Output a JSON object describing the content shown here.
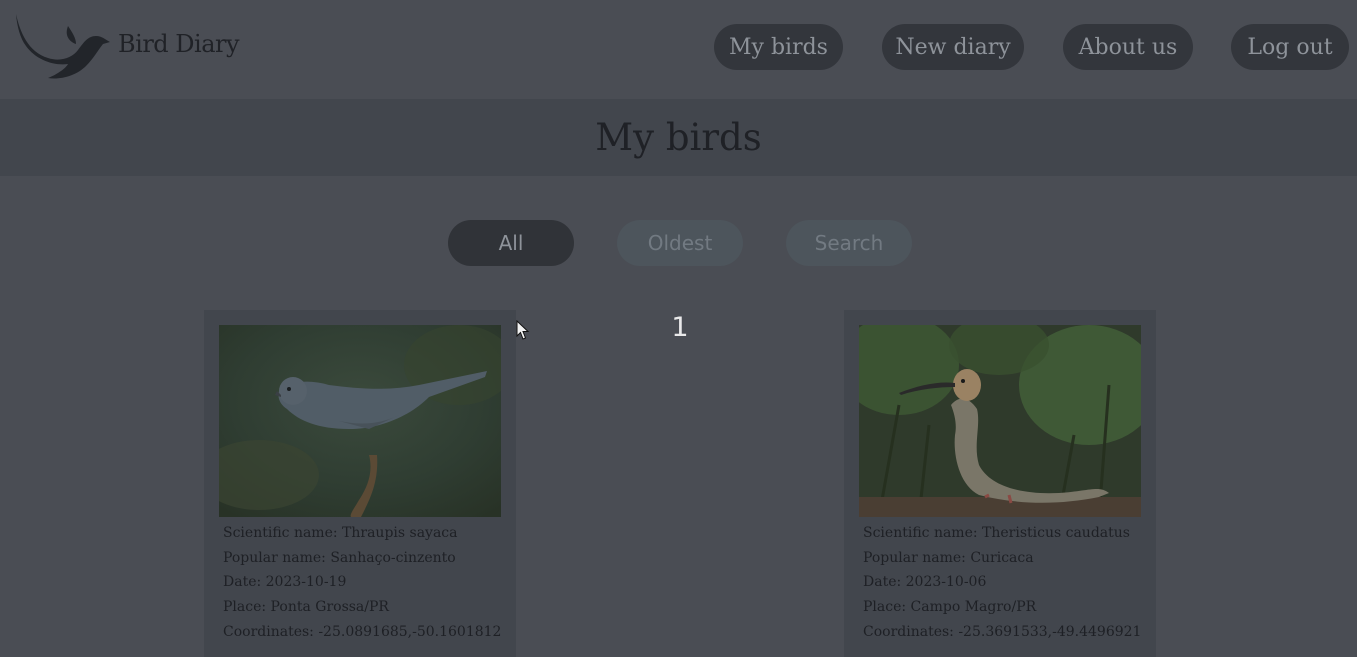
{
  "header": {
    "brand": "Bird Diary"
  },
  "nav": {
    "my_birds": "My birds",
    "new_diary": "New diary",
    "about_us": "About us",
    "log_out": "Log out"
  },
  "page": {
    "title": "My birds",
    "page_number": "1"
  },
  "filters": {
    "all": "All",
    "oldest": "Oldest",
    "search": "Search"
  },
  "cards": [
    {
      "scientific": "Scientific name: Thraupis sayaca",
      "popular": "Popular name: Sanhaço-cinzento",
      "date": "Date: 2023-10-19",
      "place": "Place: Ponta Grossa/PR",
      "coords": "Coordinates: -25.0891685,-50.1601812"
    },
    {
      "scientific": "Scientific name: Theristicus caudatus",
      "popular": "Popular name: Curicaca",
      "date": "Date: 2023-10-06",
      "place": "Place: Campo Magro/PR",
      "coords": "Coordinates: -25.3691533,-49.4496921"
    }
  ],
  "colors": {
    "overlay_background": "#4a4d54",
    "button_dark": "#33363c",
    "button_muted": "#4d555c"
  }
}
